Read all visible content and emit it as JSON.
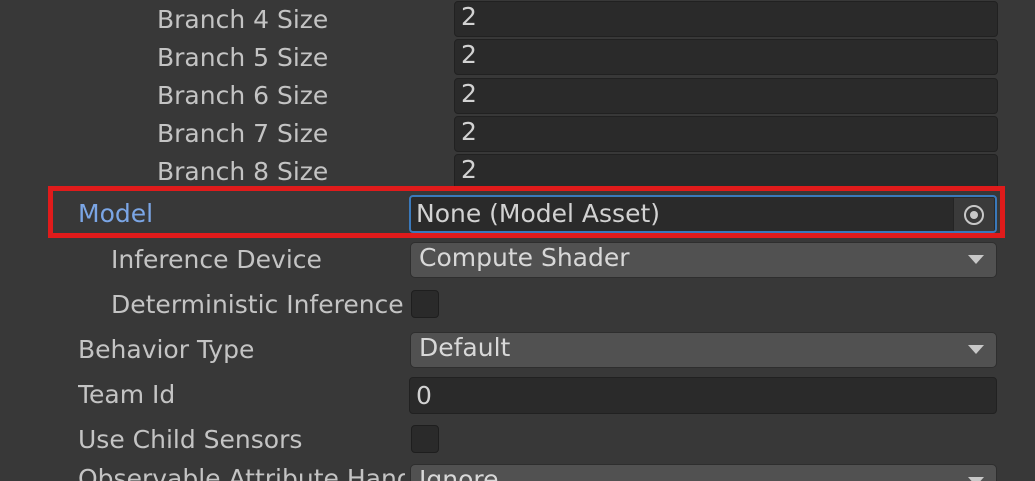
{
  "inspector": {
    "branches": [
      {
        "label": "Branch 4 Size",
        "value": "2"
      },
      {
        "label": "Branch 5 Size",
        "value": "2"
      },
      {
        "label": "Branch 6 Size",
        "value": "2"
      },
      {
        "label": "Branch 7 Size",
        "value": "2"
      },
      {
        "label": "Branch 8 Size",
        "value": "2"
      }
    ],
    "model": {
      "label": "Model",
      "value": "None (Model Asset)"
    },
    "inference_device": {
      "label": "Inference Device",
      "value": "Compute Shader"
    },
    "deterministic_inference": {
      "label": "Deterministic Inference",
      "checked": false
    },
    "behavior_type": {
      "label": "Behavior Type",
      "value": "Default"
    },
    "team_id": {
      "label": "Team Id",
      "value": "0"
    },
    "use_child_sensors": {
      "label": "Use Child Sensors",
      "checked": false
    },
    "observable_attribute": {
      "label": "Observable Attribute Handling",
      "value": "Ignore"
    }
  },
  "colors": {
    "highlight_border": "#e01b1b",
    "model_label": "#7ba6e6",
    "focus_border": "#3a79bb"
  },
  "icons": {
    "object_picker": "object-picker-icon",
    "dropdown": "chevron-down-icon"
  }
}
